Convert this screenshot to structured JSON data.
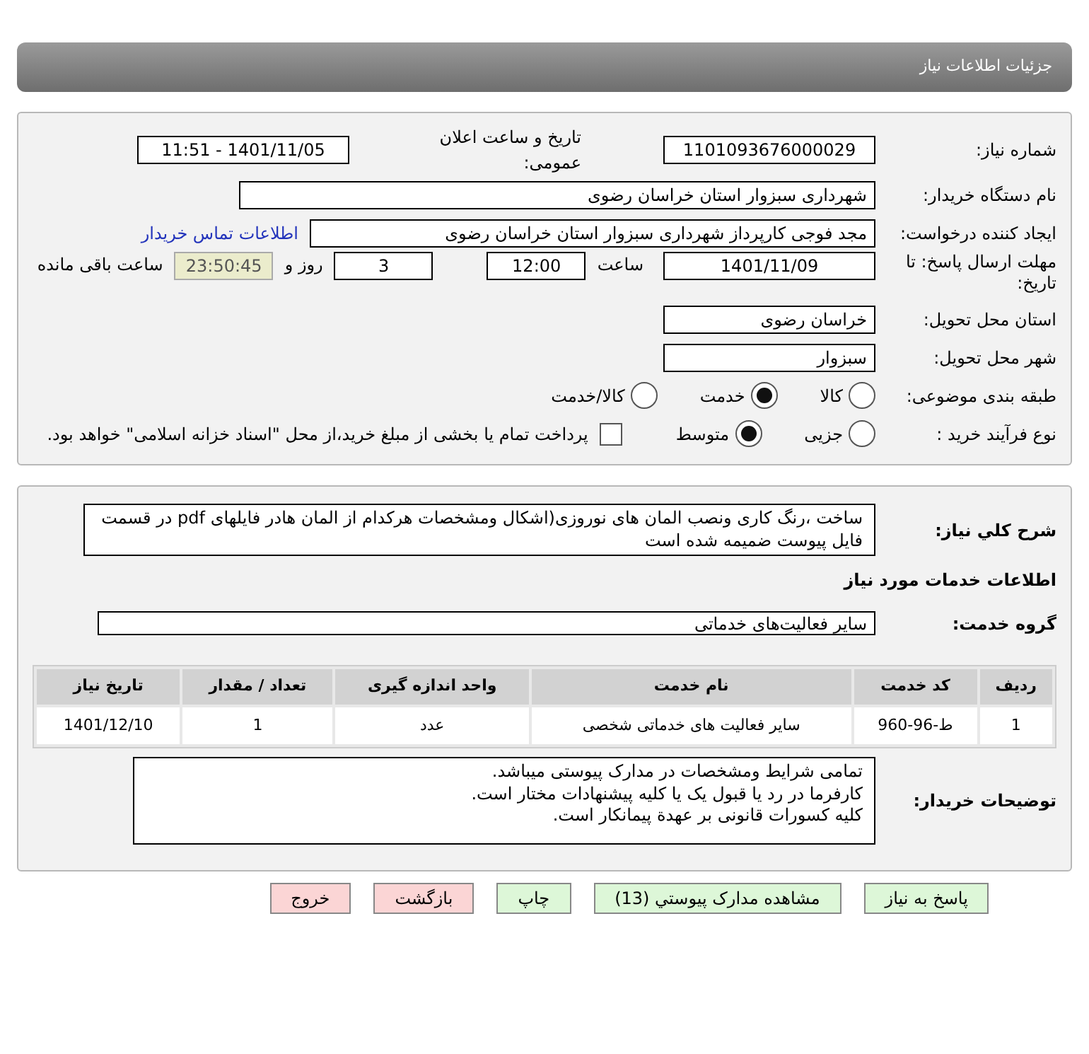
{
  "header": {
    "title": "جزئیات اطلاعات نیاز"
  },
  "need_number": {
    "label": "شماره نیاز:",
    "value": "1101093676000029"
  },
  "announce": {
    "label": "تاریخ و ساعت اعلان عمومی:",
    "value": "1401/11/05 - 11:51"
  },
  "buyer_org": {
    "label": "نام دستگاه خریدار:",
    "value": "شهرداری سبزوار استان خراسان رضوی"
  },
  "requester": {
    "label": "ایجاد کننده درخواست:",
    "value": "مجد  فوجی کارپرداز شهرداری سبزوار استان خراسان رضوی",
    "link": "اطلاعات تماس خریدار"
  },
  "deadline": {
    "label": "مهلت ارسال پاسخ: تا تاریخ:",
    "date": "1401/11/09",
    "time_label": "ساعت",
    "time": "12:00",
    "days": "3",
    "days_label": "روز و",
    "remaining": "23:50:45",
    "remaining_label": "ساعت باقی مانده"
  },
  "province": {
    "label": "استان محل تحویل:",
    "value": "خراسان رضوی"
  },
  "city": {
    "label": "شهر محل تحویل:",
    "value": "سبزوار"
  },
  "category": {
    "label": "طبقه بندی موضوعی:",
    "options": [
      {
        "label": "کالا",
        "selected": false
      },
      {
        "label": "خدمت",
        "selected": true
      },
      {
        "label": "کالا/خدمت",
        "selected": false
      }
    ]
  },
  "process": {
    "label": "نوع فرآیند خرید :",
    "options": [
      {
        "label": "جزیی",
        "selected": false
      },
      {
        "label": "متوسط",
        "selected": true
      }
    ],
    "payment": {
      "checked": false,
      "text": "پرداخت تمام یا بخشی از مبلغ خرید،از محل \"اسناد خزانه اسلامی\" خواهد بود."
    }
  },
  "description": {
    "label": "شرح کلي نیاز:",
    "text": "ساخت ،رنگ کاری ونصب المان های نوروزی(اشکال ومشخصات هرکدام از المان هادر فایلهای pdf در قسمت فایل پیوست ضمیمه شده است"
  },
  "services_heading": "اطلاعات خدمات مورد نیاز",
  "service_group": {
    "label": "گروه خدمت:",
    "value": "سایر فعالیت‌های خدماتی"
  },
  "table": {
    "columns": [
      "ردیف",
      "کد خدمت",
      "نام خدمت",
      "واحد اندازه گیری",
      "تعداد / مقدار",
      "تاریخ نیاز"
    ],
    "rows": [
      [
        "1",
        "ط-96-960",
        "سایر فعالیت های خدماتی شخصی",
        "عدد",
        "1",
        "1401/12/10"
      ]
    ]
  },
  "buyer_notes": {
    "label": "توضیحات خریدار:",
    "lines": [
      "تمامی شرایط ومشخصات در مدارک پیوستی میباشد.",
      "کارفرما در رد یا قبول یک یا کلیه پیشنهادات مختار است.",
      "کلیه کسورات قانونی بر عهدة پیمانکار است."
    ]
  },
  "buttons": [
    {
      "label": "پاسخ به نیاز",
      "kind": "normal"
    },
    {
      "label": "مشاهده مدارک پیوستي (13)",
      "kind": "normal"
    },
    {
      "label": "چاپ",
      "kind": "normal"
    },
    {
      "label": "بازگشت",
      "kind": "exit"
    },
    {
      "label": "خروج",
      "kind": "exit"
    }
  ]
}
